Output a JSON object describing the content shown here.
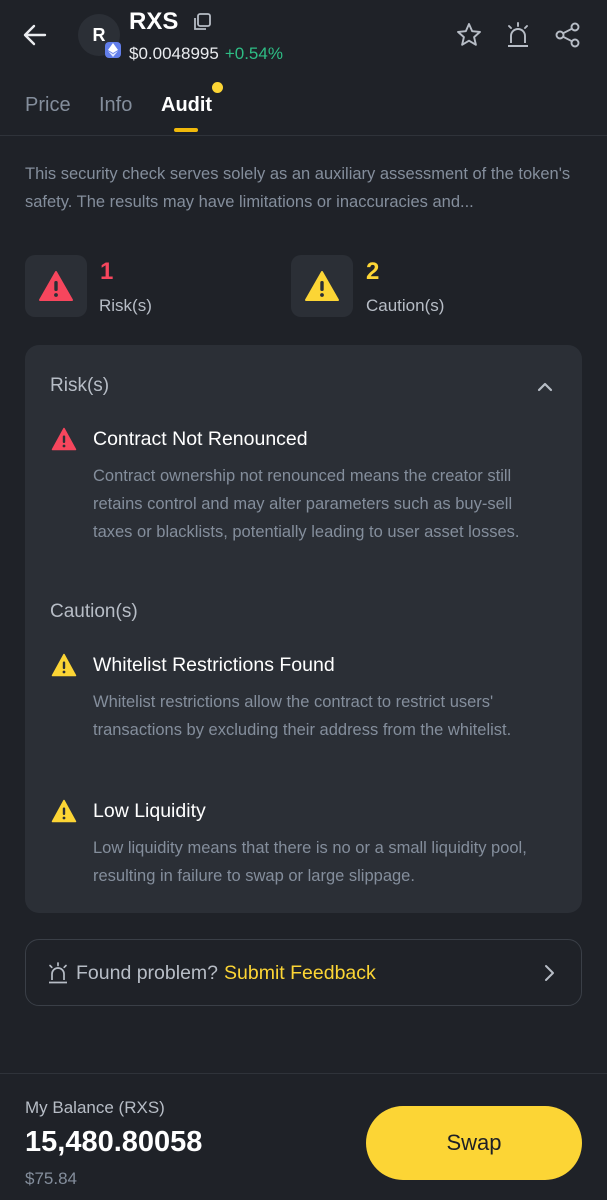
{
  "header": {
    "token_initial": "R",
    "token_symbol": "RXS",
    "price": "$0.0048995",
    "change": "+0.54%"
  },
  "tabs": [
    {
      "label": "Price",
      "active": false
    },
    {
      "label": "Info",
      "active": false
    },
    {
      "label": "Audit",
      "active": true
    }
  ],
  "disclaimer": "This security check serves solely as an auxiliary assessment of the token's safety. The results may have limitations or inaccuracies and...",
  "summary": {
    "risk_count": "1",
    "risk_label": "Risk(s)",
    "caution_count": "2",
    "caution_label": "Caution(s)"
  },
  "details": {
    "risk_section_title": "Risk(s)",
    "caution_section_title": "Caution(s)",
    "risks": [
      {
        "title": "Contract Not Renounced",
        "description": "Contract ownership not renounced means the creator still retains control and may alter parameters such as buy-sell taxes or blacklists, potentially leading to user asset losses."
      }
    ],
    "cautions": [
      {
        "title": "Whitelist Restrictions Found",
        "description": "Whitelist restrictions allow the contract to restrict users' transactions by excluding their address from the whitelist."
      },
      {
        "title": "Low Liquidity",
        "description": "Low liquidity means that there is no or a small liquidity pool, resulting in failure to swap or large slippage."
      }
    ]
  },
  "feedback": {
    "prompt": "Found problem?",
    "link": "Submit Feedback"
  },
  "bottom_bar": {
    "balance_label": "My Balance (RXS)",
    "balance_value": "15,480.80058",
    "balance_usd": "$75.84",
    "swap_label": "Swap"
  },
  "colors": {
    "background": "#1f2228",
    "card": "#2b2f36",
    "accent_yellow": "#fcd535",
    "risk_red": "#f6465d",
    "positive_green": "#2ebd85"
  },
  "icons": [
    "back-arrow-icon",
    "ethereum-icon",
    "copy-icon",
    "star-icon",
    "alert-siren-icon",
    "share-icon",
    "risk-warning-icon",
    "caution-warning-icon",
    "chevron-up-icon",
    "chevron-right-icon"
  ]
}
